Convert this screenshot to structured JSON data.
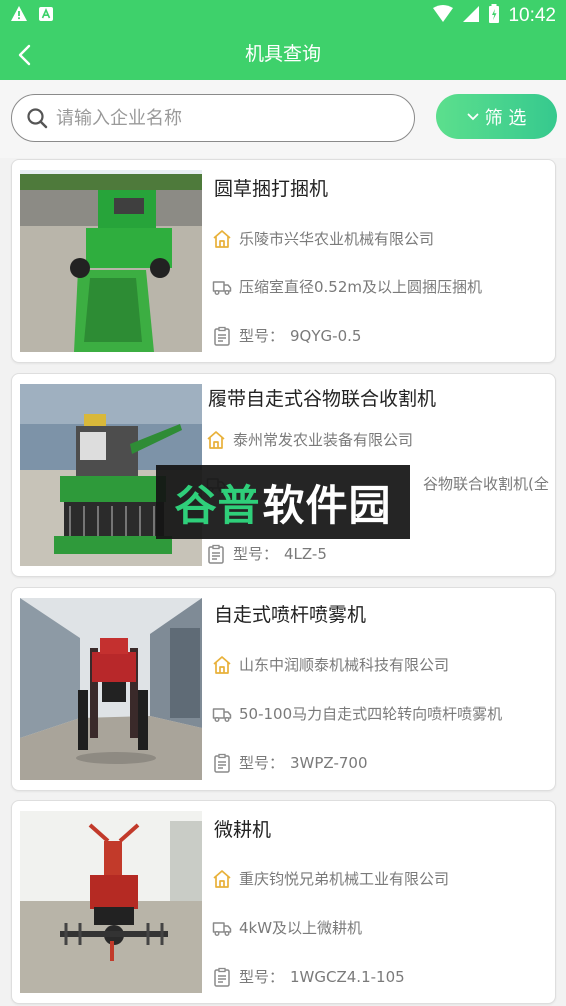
{
  "status_bar": {
    "time": "10:42"
  },
  "header": {
    "title": "机具查询"
  },
  "search": {
    "placeholder": "请输入企业名称",
    "filter_label": "筛 选"
  },
  "colors": {
    "primary": "#3ed16b",
    "filter_gradient_start": "#5cdf8d",
    "filter_gradient_end": "#36c98e",
    "icon_company": "#e8b13a"
  },
  "model_prefix": "型号：",
  "machines": [
    {
      "name": "圆草捆打捆机",
      "company": "乐陵市兴华农业机械有限公司",
      "spec": "压缩室直径0.52m及以上圆捆压捆机",
      "model": "9QYG-0.5",
      "image": "round-baler-photo"
    },
    {
      "name": "履带自走式谷物联合收割机",
      "company": "泰州常发农业装备有限公司",
      "spec": "谷物联合收割机(全",
      "model": "4LZ-5",
      "image": "crawler-harvester-photo"
    },
    {
      "name": "自走式喷杆喷雾机",
      "company": "山东中润顺泰机械科技有限公司",
      "spec": "50-100马力自走式四轮转向喷杆喷雾机",
      "model": "3WPZ-700",
      "image": "boom-sprayer-photo"
    },
    {
      "name": "微耕机",
      "company": "重庆钧悦兄弟机械工业有限公司",
      "spec": "4kW及以上微耕机",
      "model": "1WGCZ4.1-105",
      "image": "mini-tiller-photo"
    }
  ],
  "watermark": {
    "part1": "谷普",
    "part2": "软件园"
  }
}
